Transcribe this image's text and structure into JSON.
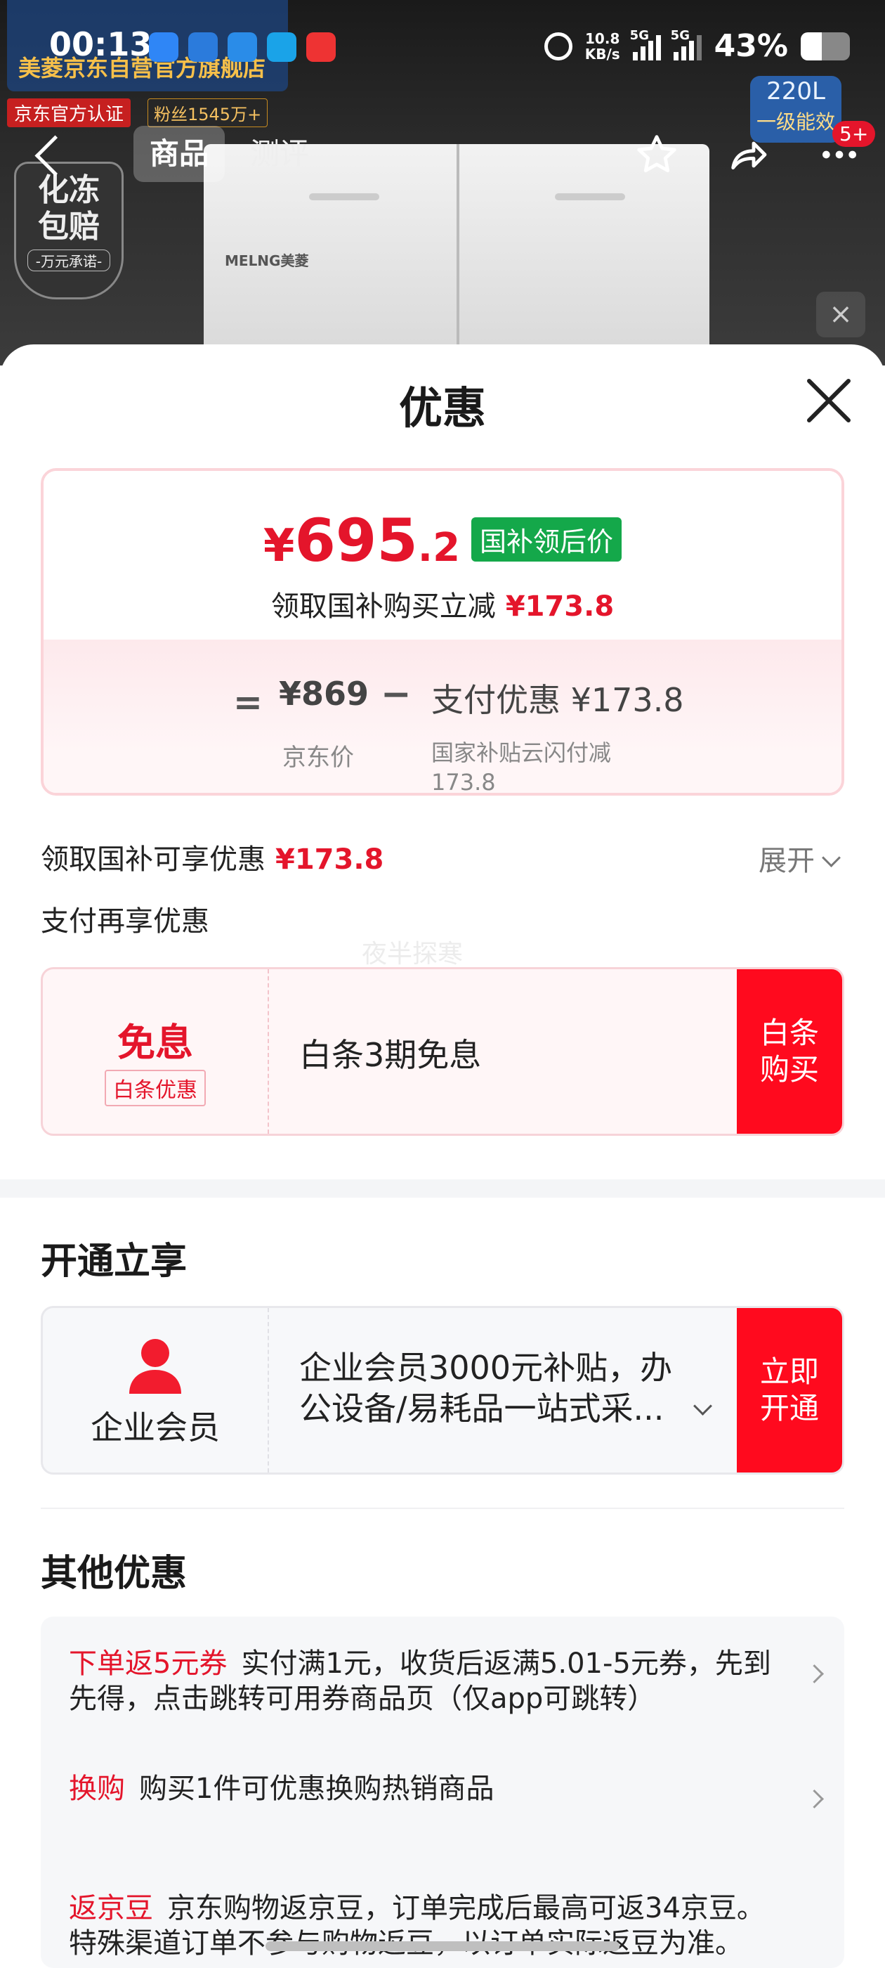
{
  "status_bar": {
    "time": "00:13",
    "net_speed_value": "10.8",
    "net_speed_unit": "KB/s",
    "sim1": "5G",
    "sim2": "5G",
    "battery": "43%"
  },
  "product_banner": {
    "store_name": "美菱京东自营官方旗舰店",
    "official_tag": "京东官方认证",
    "fans_tag": "粉丝1545万+",
    "badge_line1": "化冻",
    "badge_line2": "包赔",
    "badge_line3": "-万元承诺-",
    "capacity": "220L",
    "energy": "一级能效",
    "brand_print": "MELNG美菱"
  },
  "nav": {
    "tab_product": "商品",
    "tab_review": "测评",
    "notif_count": "5+"
  },
  "sheet": {
    "title": "优惠",
    "price_yen": "¥",
    "price_int": "695",
    "price_dec": ".2",
    "gb_tag": "国补领后价",
    "claim_text": "领取国补购买立减",
    "claim_amount": "¥173.8",
    "equals": "=",
    "jd_price": "¥869",
    "minus": "−",
    "pay_discount": "支付优惠 ¥173.8",
    "jd_label": "京东价",
    "pay_label": "国家补贴云闪付减173.8",
    "gb_row_text": "领取国补可享优惠",
    "gb_row_amount": "¥173.8",
    "expand_label": "展开",
    "pay_row_text": "支付再享优惠",
    "watermark": "夜半探寒"
  },
  "baitiao": {
    "big": "免息",
    "small": "白条优惠",
    "desc": "白条3期免息",
    "button": "白条\n购买"
  },
  "membership": {
    "section_title": "开通立享",
    "label": "企业会员",
    "desc": "企业会员3000元补贴，办公设备/易耗品一站式采...",
    "button": "立即\n开通"
  },
  "other": {
    "section_title": "其他优惠",
    "offers": [
      {
        "tag": "下单返5元券",
        "text": "实付满1元，收货后返满5.01-5元券，先到先得，点击跳转可用券商品页（仅app可跳转）"
      },
      {
        "tag": "换购",
        "text": "购买1件可优惠换购热销商品"
      },
      {
        "tag": "返京豆",
        "text": "京东购物返京豆，订单完成后最高可返34京豆。特殊渠道订单不参与购物返豆，以订单实际返豆为准。"
      }
    ]
  },
  "colors": {
    "accent_red": "#e4152b",
    "button_red": "#ff0a1e",
    "gb_green": "#14a84a"
  },
  "icons": [
    "back-icon",
    "star-icon",
    "share-icon",
    "more-icon",
    "close-icon",
    "chevron-down-icon",
    "chevron-right-icon",
    "user-icon",
    "alarm-icon",
    "battery-icon"
  ]
}
